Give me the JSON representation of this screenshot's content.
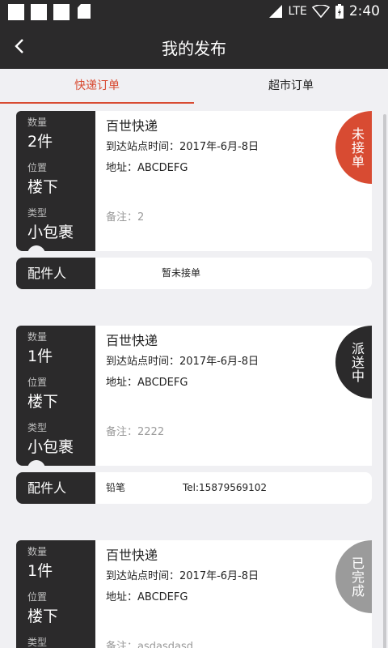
{
  "status": {
    "network": "LTE",
    "time": "2:40"
  },
  "header": {
    "title": "我的发布"
  },
  "tabs": [
    {
      "label": "快递订单",
      "active": true
    },
    {
      "label": "超市订单",
      "active": false
    }
  ],
  "colors": {
    "accent": "#d84b32",
    "dark": "#2b2a2b",
    "status_pending": "#d84b32",
    "status_delivering": "#2b2a2b",
    "status_done": "#9b9b9b"
  },
  "orders": [
    {
      "qty_label": "数量",
      "qty": "2件",
      "pos_label": "位置",
      "pos": "楼下",
      "type_label": "类型",
      "type": "小包裹",
      "company": "百世快递",
      "arrival": "到达站点时间：2017年-6月-8日",
      "address": "地址：ABCDEFG",
      "remark": "备注：2",
      "status": "未接单",
      "courier_label": "配件人",
      "courier_info": "暂未接单",
      "courier_phone": ""
    },
    {
      "qty_label": "数量",
      "qty": "1件",
      "pos_label": "位置",
      "pos": "楼下",
      "type_label": "类型",
      "type": "小包裹",
      "company": "百世快递",
      "arrival": "到达站点时间：2017年-6月-8日",
      "address": "地址：ABCDEFG",
      "remark": "备注：2222",
      "status": "派送中",
      "courier_label": "配件人",
      "courier_info": "铅笔",
      "courier_phone": "Tel:15879569102"
    },
    {
      "qty_label": "数量",
      "qty": "1件",
      "pos_label": "位置",
      "pos": "楼下",
      "type_label": "类型",
      "type": "",
      "company": "百世快递",
      "arrival": "到达站点时间：2017年-6月-8日",
      "address": "地址：ABCDEFG",
      "remark": "备注：asdasdasd",
      "status": "已完成",
      "courier_label": "",
      "courier_info": "",
      "courier_phone": ""
    }
  ]
}
